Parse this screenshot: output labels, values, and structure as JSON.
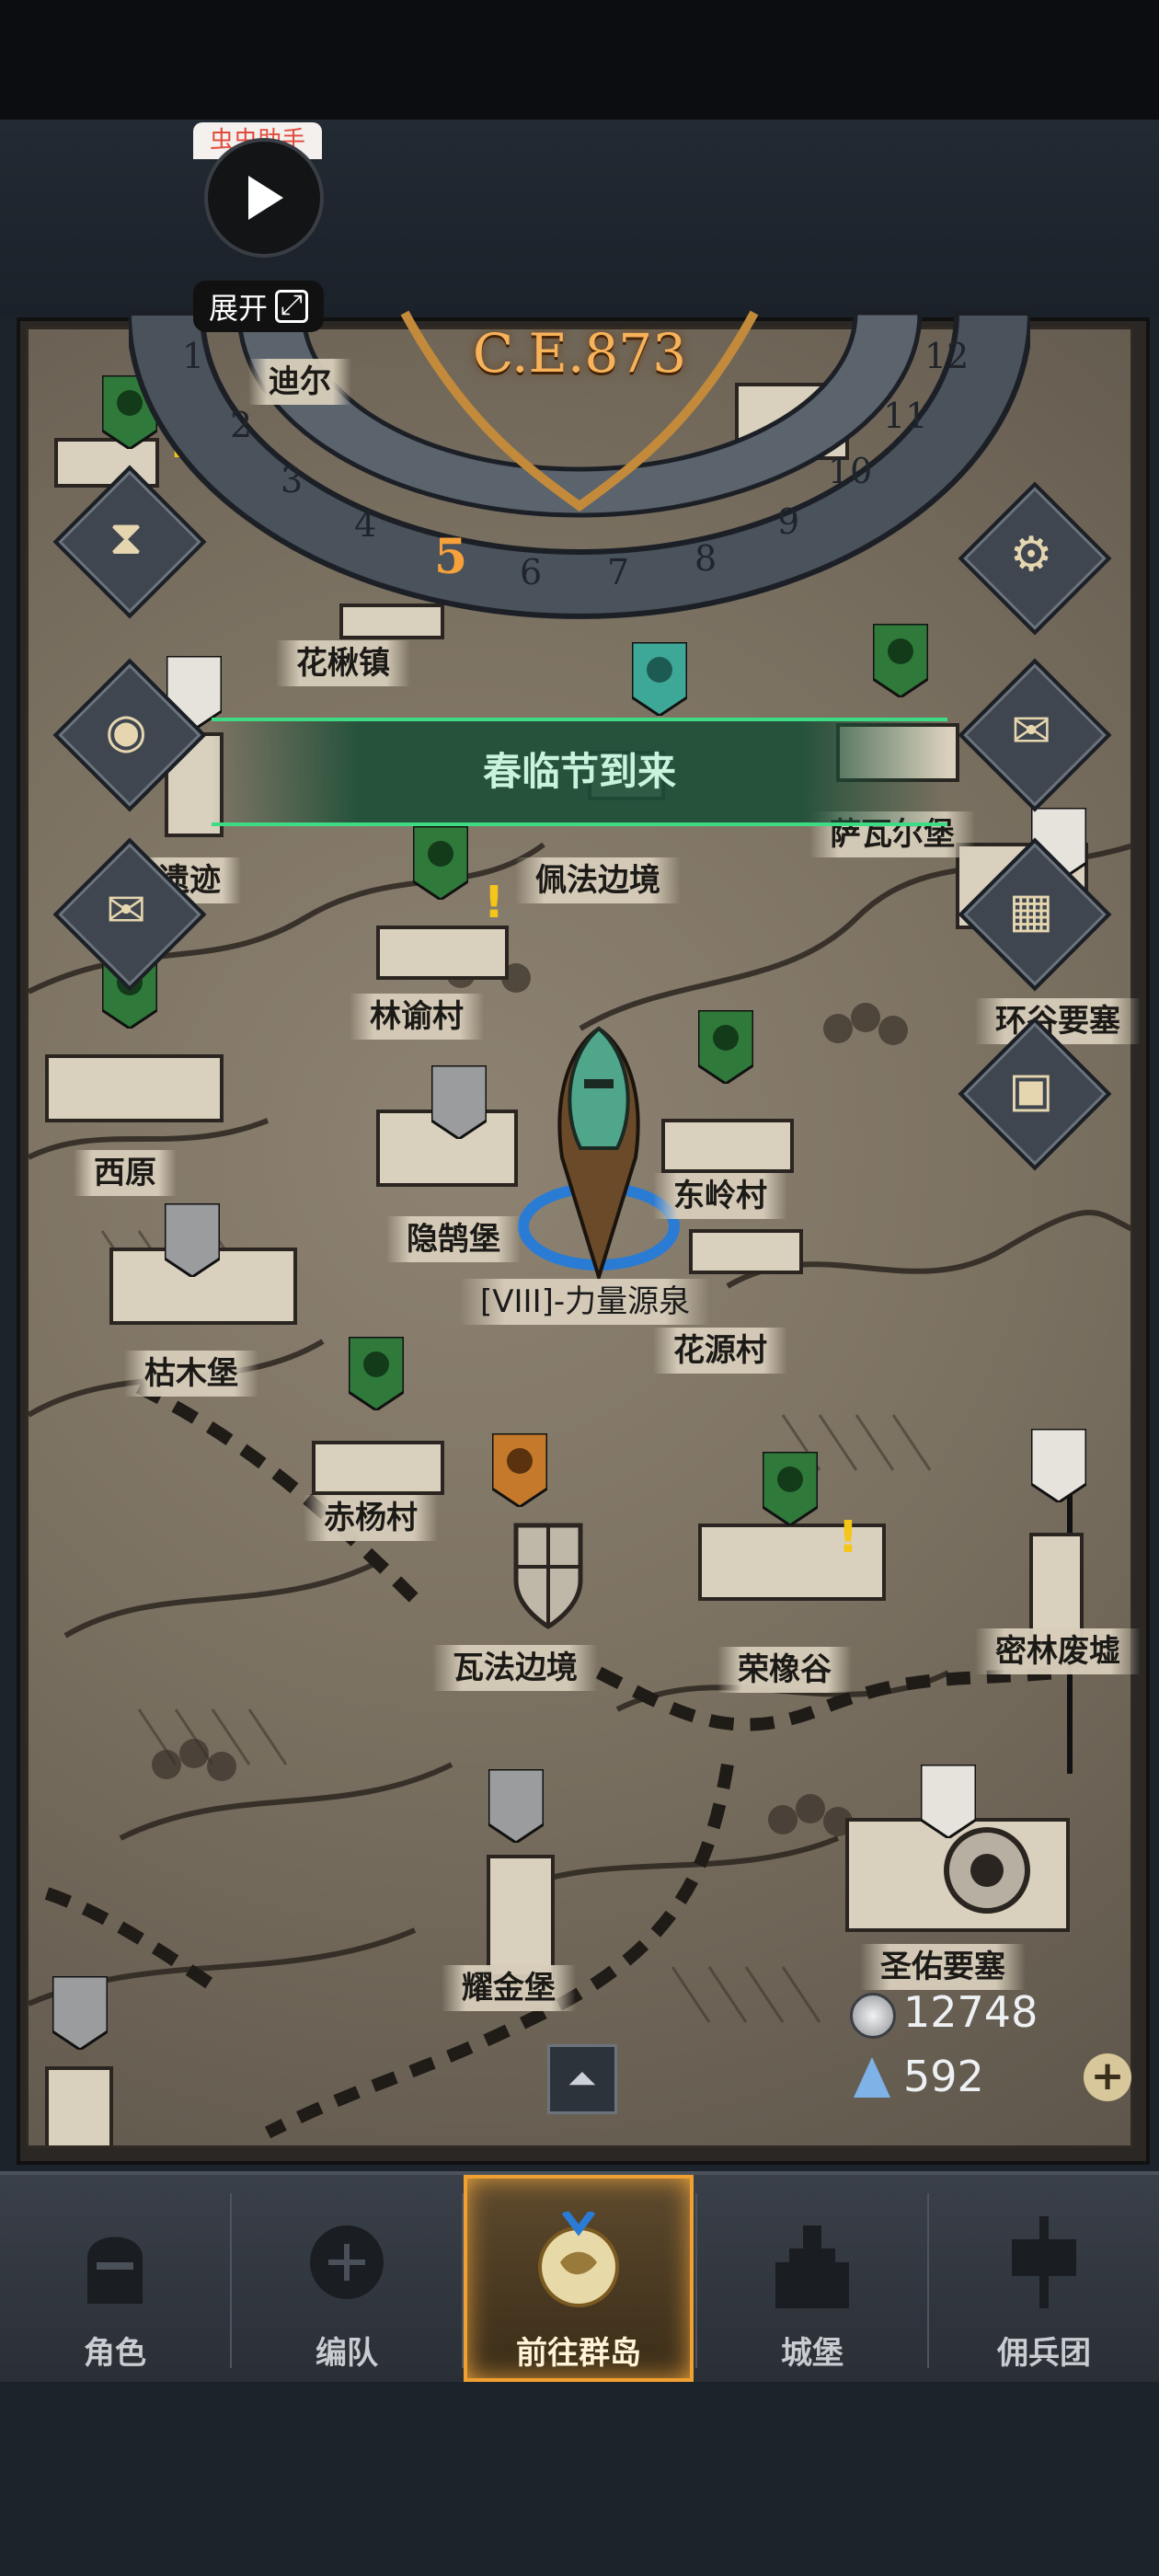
{
  "overlay": {
    "helper_tag": "虫虫助手",
    "expand_label": "展开"
  },
  "dial": {
    "era": "C.E.873",
    "months": [
      "1",
      "2",
      "3",
      "4",
      "5",
      "6",
      "7",
      "8",
      "9",
      "10",
      "11",
      "12"
    ],
    "current_month": "5"
  },
  "event_banner": "春临节到来",
  "locations": {
    "top_left_partial": "迪尔",
    "huajiao": "花楸镇",
    "yiji": "遗迹",
    "peifa": "佩法边境",
    "sawaer": "萨瓦尔堡",
    "linyu": "林谕村",
    "huangu": "环谷要塞",
    "xiyuan": "西原",
    "yinhu": "隐鹄堡",
    "dongling": "东岭村",
    "power_spring": "[VIII]-力量源泉",
    "huayuan": "花源村",
    "kumu": "枯木堡",
    "chiyang": "赤杨村",
    "wafa": "瓦法边境",
    "rongxiang": "荣橡谷",
    "milin": "密林废墟",
    "yaojin": "耀金堡",
    "shengyou": "圣佑要塞"
  },
  "currency": {
    "silver": "12748",
    "crystal": "592"
  },
  "nav": {
    "items": [
      "角色",
      "编队",
      "前往群岛",
      "城堡",
      "佣兵团"
    ],
    "selected": "前往群岛"
  },
  "colors": {
    "banner_green": "#3ddc84",
    "era_gold": "#f7b25a",
    "nav_highlight": "#f0a030",
    "alert_yellow": "#f5c518"
  }
}
